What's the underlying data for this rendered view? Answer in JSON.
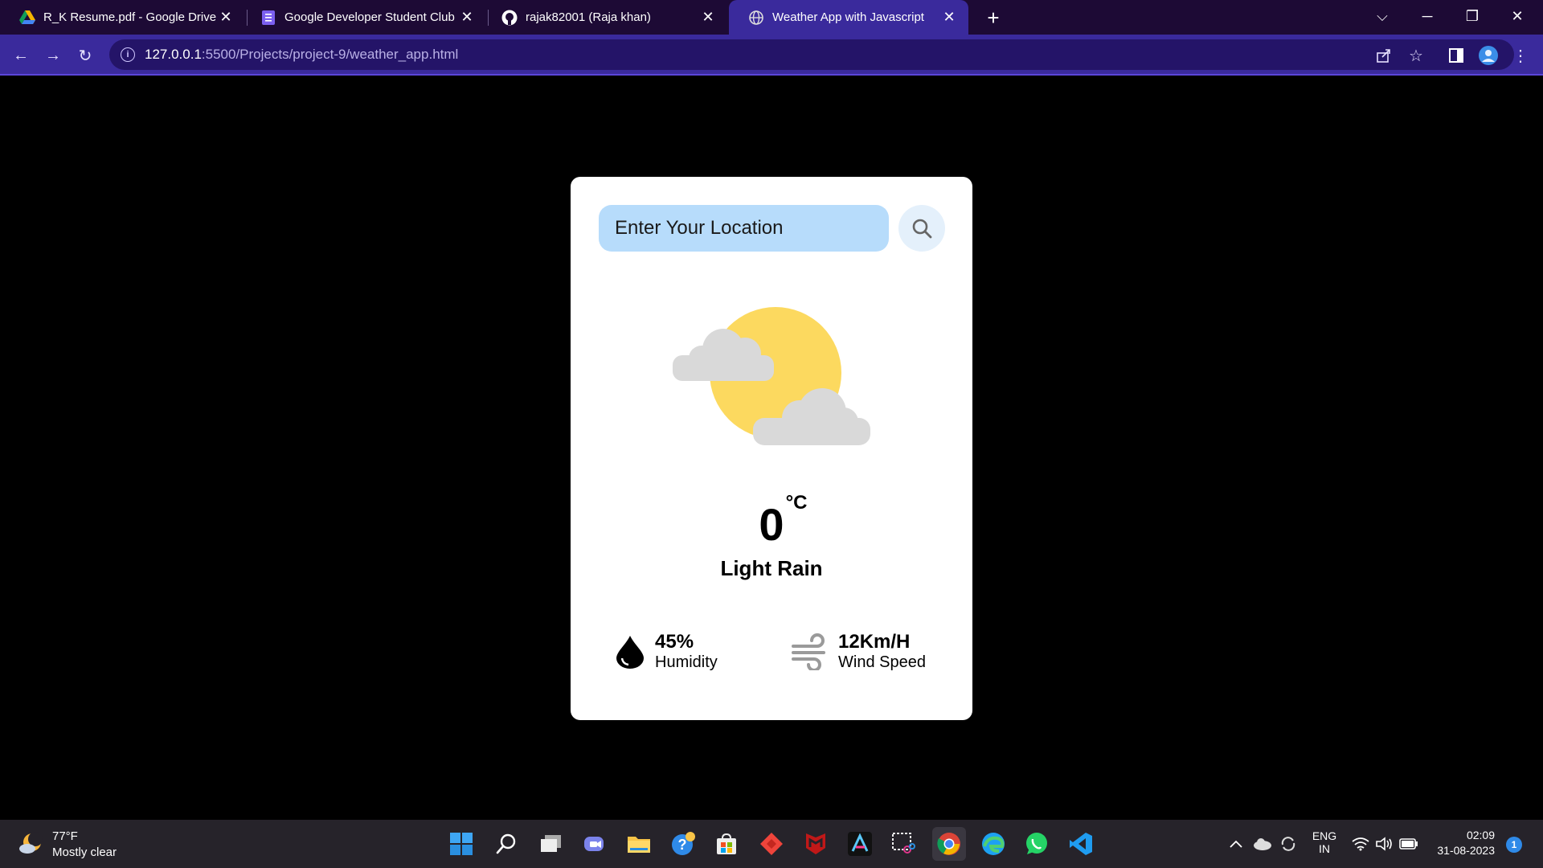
{
  "browser": {
    "tabs": [
      {
        "title": "R_K Resume.pdf - Google Drive",
        "favicon": "google-drive-icon"
      },
      {
        "title": "Google Developer Student Club",
        "favicon": "google-forms-icon"
      },
      {
        "title": "rajak82001 (Raja khan)",
        "favicon": "github-icon"
      },
      {
        "title": "Weather App with Javascript",
        "favicon": "globe-icon",
        "active": true
      }
    ],
    "url_host": "127.0.0.1",
    "url_path": ":5500/Projects/project-9/weather_app.html"
  },
  "app": {
    "search_placeholder": "Enter Your Location",
    "temperature": "0",
    "unit": "°C",
    "condition": "Light Rain",
    "humidity_value": "45%",
    "humidity_label": "Humidity",
    "wind_value": "12Km/H",
    "wind_label": "Wind Speed"
  },
  "taskbar": {
    "weather_temp": "77°F",
    "weather_desc": "Mostly clear",
    "lang_top": "ENG",
    "lang_bottom": "IN",
    "time": "02:09",
    "date": "31-08-2023",
    "notification_count": "1"
  },
  "colors": {
    "tabstrip": "#1d0a35",
    "toolbar": "#3a2a9c",
    "search_field": "#b7dcfb",
    "sun": "#fcd95f",
    "cloud": "#d9d9d9"
  }
}
